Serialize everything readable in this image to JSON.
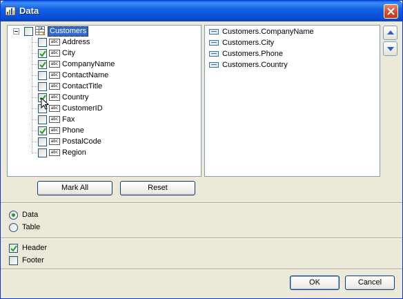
{
  "window": {
    "title": "Data",
    "app_icon": "data-window-icon",
    "close_icon": "close-icon"
  },
  "tree": {
    "root": {
      "label": "Customers",
      "checked": false,
      "expanded": true,
      "icon": "table-icon"
    },
    "fields": [
      {
        "label": "Address",
        "checked": false
      },
      {
        "label": "City",
        "checked": true
      },
      {
        "label": "CompanyName",
        "checked": true
      },
      {
        "label": "ContactName",
        "checked": false
      },
      {
        "label": "ContactTitle",
        "checked": false
      },
      {
        "label": "Country",
        "checked": true
      },
      {
        "label": "CustomerID",
        "checked": false
      },
      {
        "label": "Fax",
        "checked": false
      },
      {
        "label": "Phone",
        "checked": true
      },
      {
        "label": "PostalCode",
        "checked": false
      },
      {
        "label": "Region",
        "checked": false
      }
    ],
    "field_icon_text": "abc"
  },
  "selected_fields": [
    "Customers.CompanyName",
    "Customers.City",
    "Customers.Phone",
    "Customers.Country"
  ],
  "buttons": {
    "mark_all": "Mark All",
    "reset": "Reset",
    "ok": "OK",
    "cancel": "Cancel"
  },
  "source_options": [
    {
      "label": "Data",
      "selected": true
    },
    {
      "label": "Table",
      "selected": false
    }
  ],
  "bands": [
    {
      "label": "Header",
      "checked": true
    },
    {
      "label": "Footer",
      "checked": false
    }
  ],
  "colors": {
    "title_bar": "#0a4fd6",
    "selection": "#316ac5",
    "check": "#21a121",
    "dialog_bg": "#ece9d8"
  }
}
